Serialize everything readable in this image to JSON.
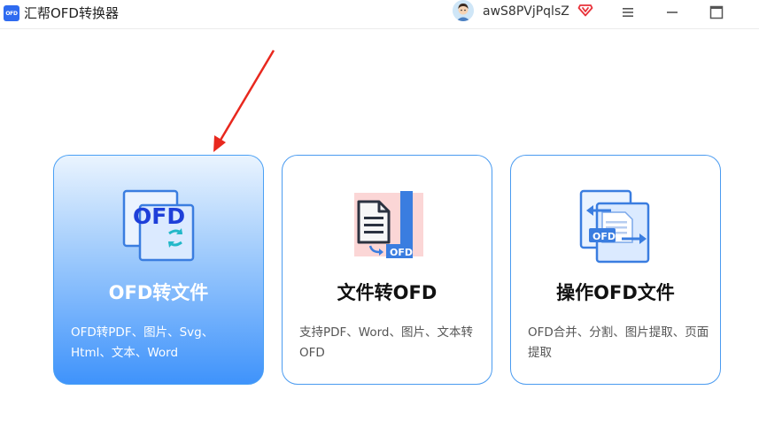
{
  "app": {
    "logo_text": "OFD",
    "title": "汇帮OFD转换器"
  },
  "user": {
    "username": "awS8PVjPqlsZ"
  },
  "window_controls": [
    "menu-icon",
    "minimize-icon",
    "maximize-icon"
  ],
  "cards": [
    {
      "title": "OFD转文件",
      "description": "OFD转PDF、图片、Svg、Html、文本、Word",
      "icon": "ofd-convert-icon",
      "icon_text": "OFD",
      "active": true
    },
    {
      "title": "文件转OFD",
      "description": "支持PDF、Word、图片、文本转OFD",
      "icon": "document-to-ofd-icon",
      "icon_text": "OFD",
      "active": false
    },
    {
      "title": "操作OFD文件",
      "description": "OFD合并、分割、图片提取、页面提取",
      "icon": "ofd-operate-icon",
      "icon_text": "OFD",
      "active": false
    }
  ],
  "colors": {
    "accent": "#2f6bf0",
    "card_border": "#4a9bf0",
    "active_gradient_top": "#eaf4fe",
    "active_gradient_bottom": "#3f93fb",
    "annotation_arrow": "#e8281e"
  }
}
